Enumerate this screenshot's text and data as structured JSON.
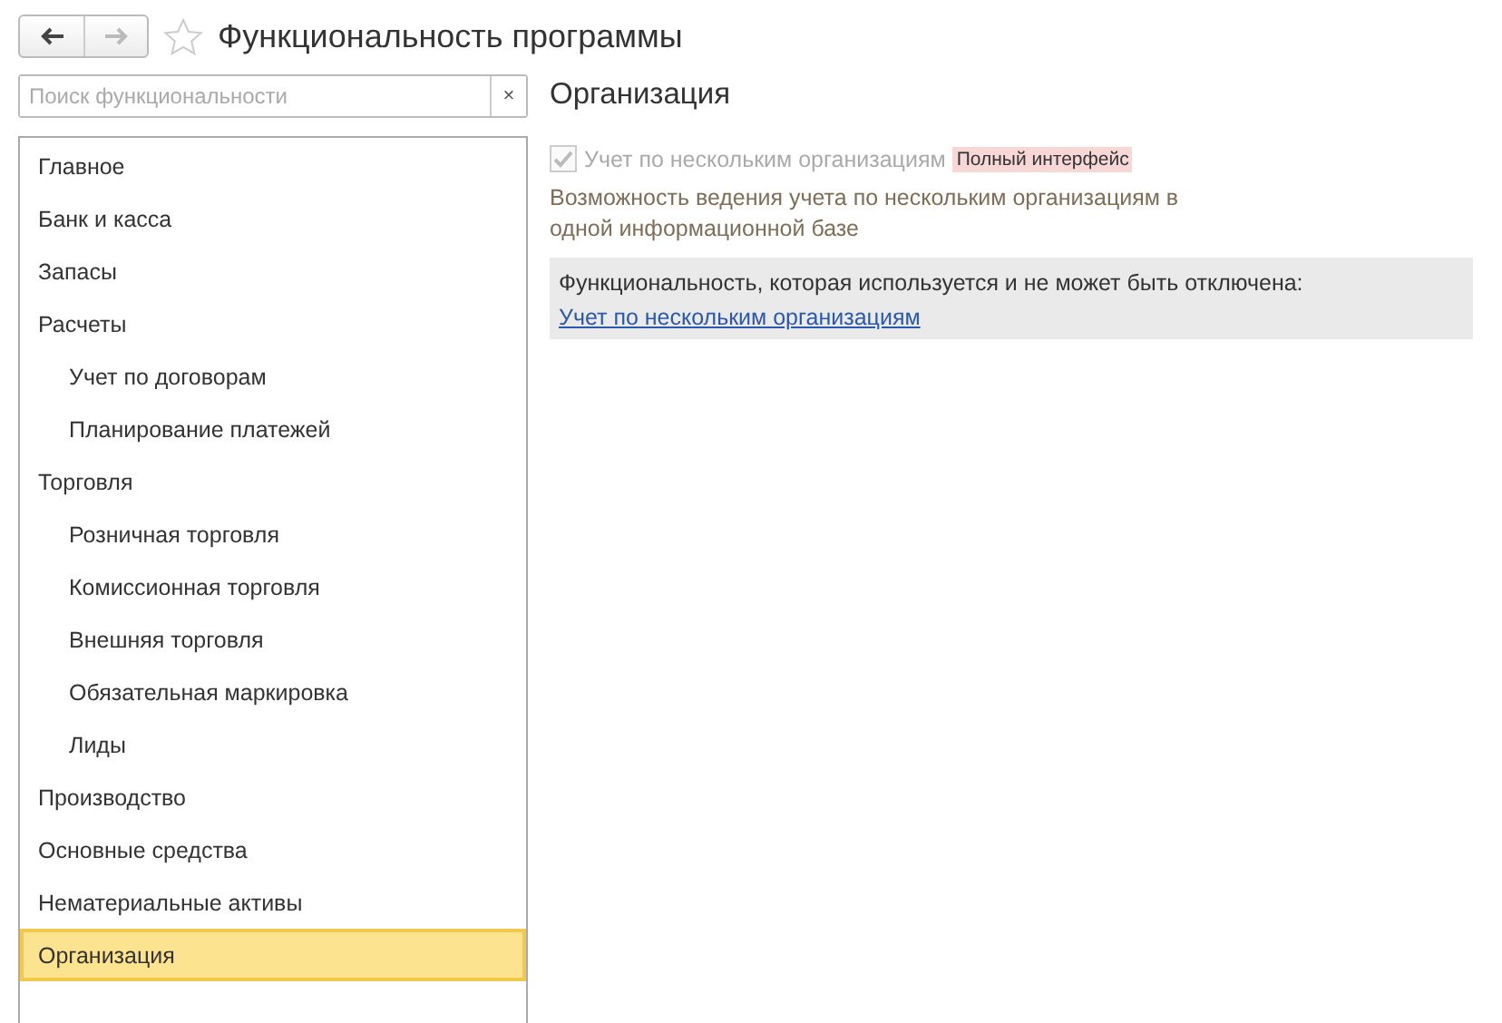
{
  "window": {
    "title": "Функциональность программы",
    "back_enabled": true,
    "forward_enabled": false
  },
  "search": {
    "placeholder": "Поиск функциональности",
    "clear": "×"
  },
  "sections": [
    {
      "label": "Главное",
      "selected": false
    },
    {
      "label": "Банк и касса",
      "selected": false
    },
    {
      "label": "Запасы",
      "selected": false
    },
    {
      "label": "Расчеты",
      "selected": false,
      "children": [
        {
          "label": "Учет по договорам",
          "selected": false
        },
        {
          "label": "Планирование платежей",
          "selected": false
        }
      ]
    },
    {
      "label": "Торговля",
      "selected": false,
      "children": [
        {
          "label": "Розничная торговля",
          "selected": false
        },
        {
          "label": "Комиссионная торговля",
          "selected": false
        },
        {
          "label": "Внешняя торговля",
          "selected": false
        },
        {
          "label": "Обязательная маркировка",
          "selected": false
        },
        {
          "label": "Лиды",
          "selected": false
        }
      ]
    },
    {
      "label": "Производство",
      "selected": false
    },
    {
      "label": "Основные средства",
      "selected": false
    },
    {
      "label": "Нематериальные активы",
      "selected": false
    },
    {
      "label": "Организация",
      "selected": true
    }
  ],
  "content": {
    "title": "Организация",
    "option": {
      "label": "Учет по нескольким организациям",
      "checked": true,
      "disabled": true,
      "badge": "Полный интерфейс"
    },
    "description": "Возможность ведения учета по нескольким организациям в одной информационной базе",
    "notice": {
      "text": "Функциональность, которая используется и не может быть отключена:",
      "link": "Учет по нескольким организациям"
    }
  }
}
